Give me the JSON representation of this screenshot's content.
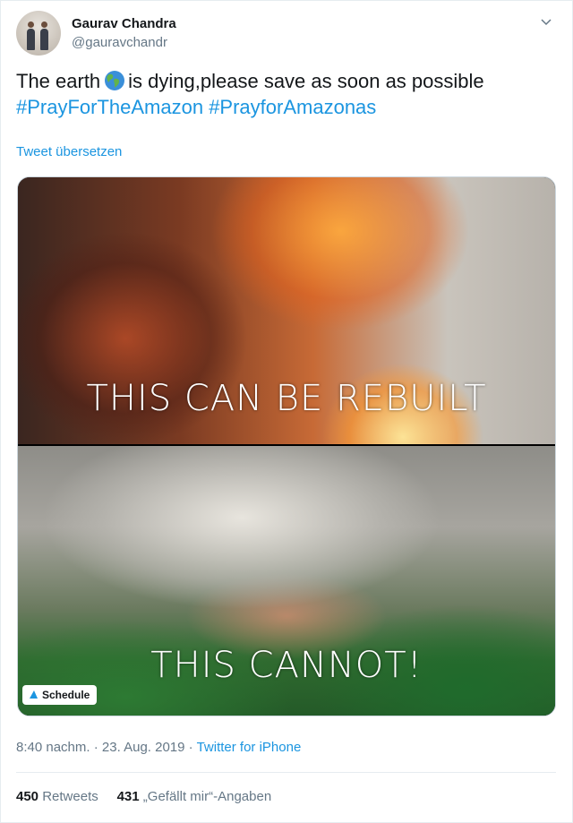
{
  "author": {
    "name": "Gaurav Chandra",
    "handle": "@gauravchandr"
  },
  "tweet": {
    "text_before_emoji": "The earth",
    "emoji": "earth-globe-americas",
    "text_after_emoji": "is dying,please save as soon as possible",
    "hashtags": "#PrayForTheAmazon #PrayforAmazonas"
  },
  "translate_link": "Tweet übersetzen",
  "media": {
    "image_top_caption": "THIS CAN BE REBUILT",
    "image_bottom_caption": "THIS CANNOT!",
    "schedule_label": "Schedule"
  },
  "meta": {
    "time": "8:40 nachm.",
    "separator": "·",
    "date": "23. Aug. 2019",
    "source": "Twitter for iPhone"
  },
  "stats": {
    "retweets_count": "450",
    "retweets_label": "Retweets",
    "likes_count": "431",
    "likes_label": "„Gefällt mir“-Angaben"
  },
  "colors": {
    "link": "#1b95e0",
    "secondary_text": "#657786",
    "primary_text": "#14171a"
  }
}
